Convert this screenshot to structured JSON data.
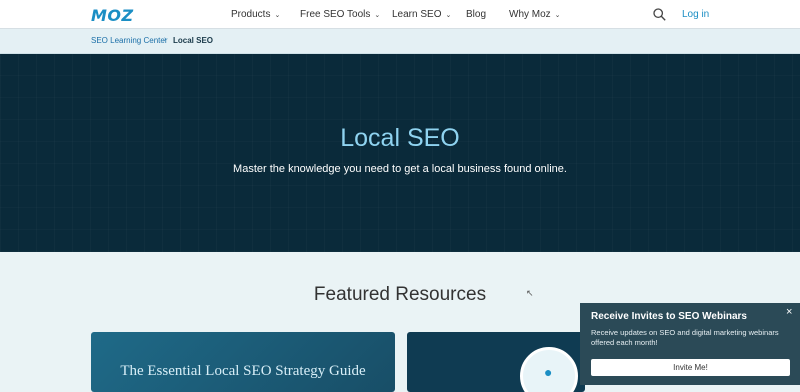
{
  "nav": {
    "logo": "MOZ",
    "items": [
      {
        "label": "Products",
        "chevron": "⌄"
      },
      {
        "label": "Free SEO Tools",
        "chevron": "⌄"
      },
      {
        "label": "Learn SEO",
        "chevron": "⌄"
      },
      {
        "label": "Blog",
        "chevron": ""
      },
      {
        "label": "Why Moz",
        "chevron": "⌄"
      }
    ],
    "search_icon": "search-icon",
    "login": "Log in"
  },
  "breadcrumb": {
    "parent": "SEO Learning Center",
    "separator": "›",
    "current": "Local SEO"
  },
  "hero": {
    "title": "Local SEO",
    "subtitle": "Master the knowledge you need to get a local business found online."
  },
  "featured": {
    "heading": "Featured Resources",
    "cards": [
      {
        "title": "The Essential Local SEO Strategy Guide"
      }
    ]
  },
  "popup": {
    "title": "Receive Invites to SEO Webinars",
    "close": "×",
    "body": "Receive updates on SEO and digital marketing webinars offered each month!",
    "button": "Invite Me!"
  },
  "colors": {
    "accent": "#1b8ec4",
    "hero_bg": "#0a2a3a",
    "hero_title": "#8fd3f0",
    "popup_bg": "#2b4a57"
  }
}
